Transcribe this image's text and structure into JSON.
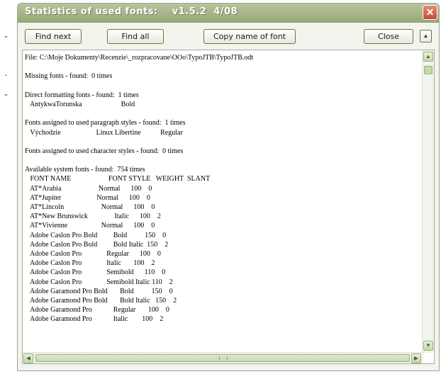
{
  "window": {
    "title": "Statistics of used fonts:    v1.5.2  4/08",
    "close_glyph": "✕"
  },
  "toolbar": {
    "find_next": "Find next",
    "find_all": "Find all",
    "copy_name": "Copy name of font",
    "close": "Close",
    "pin_glyph": "▲"
  },
  "content": {
    "lines": [
      "File: C:\\Moje Dokumenty\\Recenzie\\_rozpracovane\\OOo\\TypoJTB\\TypoJTB.odt",
      "",
      "Missing fonts - found:  0 times",
      "",
      "Direct formatting fonts - found:  1 times",
      "   AntykwaTorunska                      Bold",
      "",
      "Fonts assigned to used paragraph styles - found:  1 times",
      "   Východzie                    Linux Libertine           Regular",
      "",
      "Fonts assigned to used character styles - found:  0 times",
      "",
      "Available system fonts - found:  754 times",
      "   FONT NAME                     FONT STYLE   WEIGHT  SLANT",
      "   AT*Arabia                     Normal      100    0",
      "   AT*Jupiter                    Normal      100    0",
      "   AT*Lincoln                     Normal      100    0",
      "   AT*New Brunswick               Italic      100    2",
      "   AT*Vivienne                   Normal      100    0",
      "   Adobe Caslon Pro Bold         Bold          150    0",
      "   Adobe Caslon Pro Bold         Bold Italic  150    2",
      "   Adobe Caslon Pro              Regular      100    0",
      "   Adobe Caslon Pro              Italic       100    2",
      "   Adobe Caslon Pro              Semibold      110    0",
      "   Adobe Caslon Pro              Semibold Italic 110    2",
      "   Adobe Garamond Pro Bold       Bold          150    0",
      "   Adobe Garamond Pro Bold       Bold Italic   150    2",
      "   Adobe Garamond Pro            Regular       100    0",
      "   Adobe Garamond Pro            Italic        100    2"
    ]
  },
  "scrollbars": {
    "up_glyph": "▲",
    "down_glyph": "▼",
    "left_glyph": "◀",
    "right_glyph": "▶"
  },
  "background_fragment": {
    "marks": [
      "-",
      "·",
      "-"
    ]
  }
}
